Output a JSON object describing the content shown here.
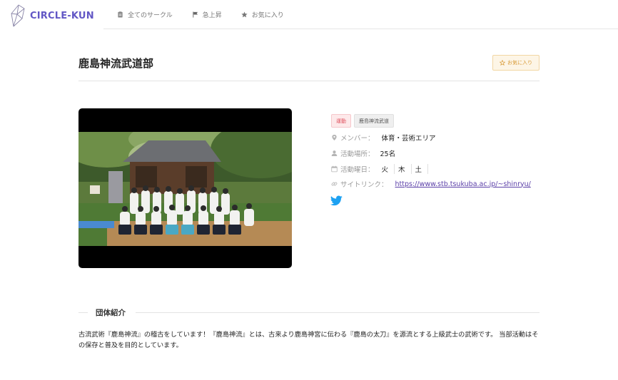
{
  "brand": {
    "name": "CIRCLE-KUN",
    "icon": "crystal-logo-icon",
    "color": "#6257c5"
  },
  "nav": {
    "items": [
      {
        "label": "全てのサークル",
        "icon": "clipboard-icon"
      },
      {
        "label": "急上昇",
        "icon": "flag-icon"
      },
      {
        "label": "お気に入り",
        "icon": "star-icon"
      }
    ]
  },
  "circle": {
    "name": "鹿島神流武道部",
    "favorite_label": "お気に入り",
    "tags": [
      {
        "label": "運動",
        "color": "#e0525f"
      },
      {
        "label": "鹿島神流武道",
        "color": "#555555"
      }
    ],
    "members": {
      "label": "メンバー：",
      "value": "体育・芸術エリア",
      "icon": "map-pin-icon"
    },
    "place": {
      "label": "活動場所：",
      "value": "25名",
      "icon": "person-icon"
    },
    "days": {
      "label": "活動曜日：",
      "values": [
        "火",
        "木",
        "土"
      ],
      "icon": "calendar-icon"
    },
    "site": {
      "label": "サイトリンク：",
      "url": "https://www.stb.tsukuba.ac.jp/~shinryu/",
      "icon": "link-icon"
    },
    "social": {
      "icon": "twitter-icon",
      "color": "#1da1f2"
    }
  },
  "intro": {
    "heading": "団体紹介",
    "text": "古流武術『鹿島神流』の稽古をしています！『鹿島神流』とは、古来より鹿島神宮に伝わる『鹿島の太刀』を源流とする上級武士の武術です。 当部活動はその保存と普及を目的としています。"
  }
}
